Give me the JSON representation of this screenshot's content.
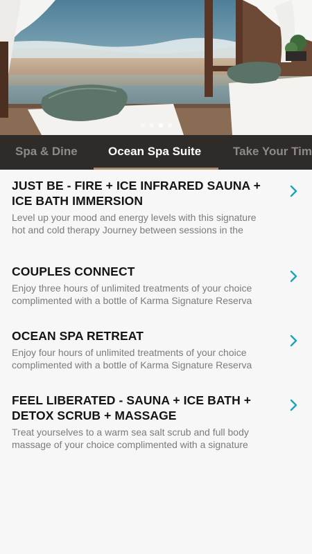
{
  "hero": {
    "image": "seaside-spa-treatment-room",
    "slide_count": 4,
    "active_slide": 2
  },
  "tabs": [
    {
      "label": "Spa & Dine",
      "active": false
    },
    {
      "label": "Ocean Spa Suite",
      "active": true
    },
    {
      "label": "Take Your Time",
      "active": false
    }
  ],
  "colors": {
    "tab_bar": "#2f2b29",
    "tab_underline": "#a88e6a",
    "chevron": "#1aa3b8",
    "title": "#141414",
    "description": "#7b7b7b"
  },
  "treatments": [
    {
      "title": "JUST BE - FIRE + ICE INFRARED SAUNA + ICE BATH IMMERSION",
      "description": "Level up your mood and energy levels with this signature hot and cold therapy Journey between sessions in the",
      "icon": "chevron-right-icon"
    },
    {
      "title": "COUPLES CONNECT",
      "description": "Enjoy three hours of unlimited treatments of your choice complimented with a bottle of Karma Signature Reserva",
      "icon": "chevron-right-icon"
    },
    {
      "title": "OCEAN SPA RETREAT",
      "description": "Enjoy four hours of unlimited treatments of your choice complimented with a bottle of Karma Signature Reserva",
      "icon": "chevron-right-icon"
    },
    {
      "title": "FEEL LIBERATED - SAUNA + ICE BATH + DETOX SCRUB + MASSAGE",
      "description": "Treat yourselves to a warm sea salt scrub and full body massage of your choice complimented with a signature",
      "icon": "chevron-right-icon"
    }
  ]
}
